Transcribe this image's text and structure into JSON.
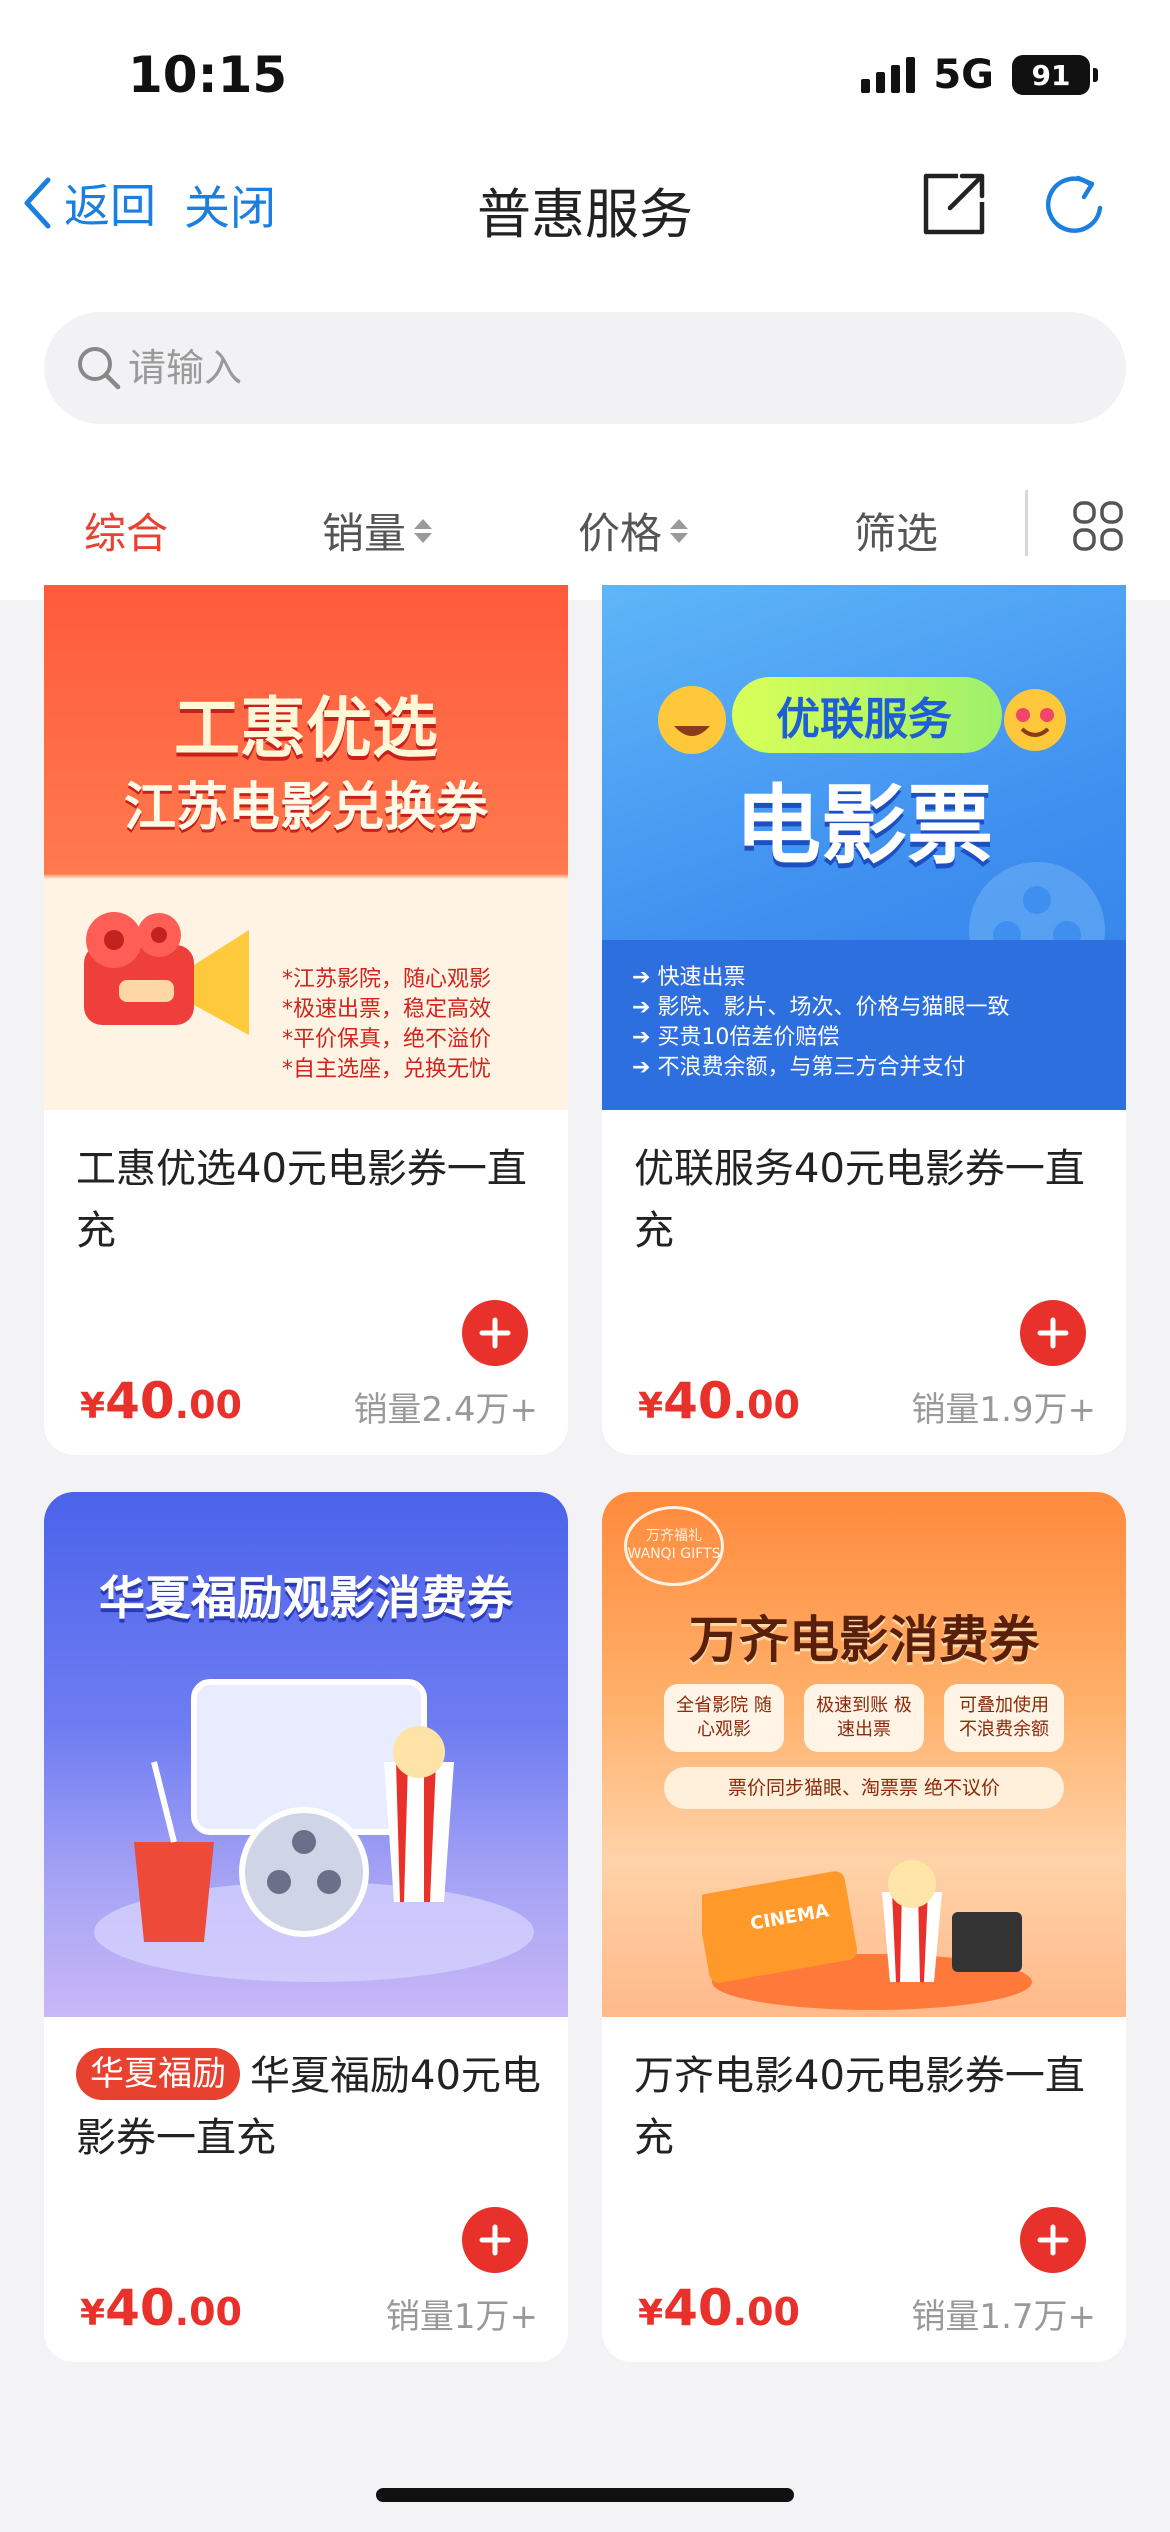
{
  "status_bar": {
    "time": "10:15",
    "network": "5G",
    "battery": "91"
  },
  "nav": {
    "back_label": "返回",
    "close_label": "关闭",
    "title": "普惠服务"
  },
  "search": {
    "placeholder": "请输入"
  },
  "sort_tabs": {
    "comprehensive": "综合",
    "sales": "销量",
    "price": "价格",
    "filter": "筛选"
  },
  "colors": {
    "accent_red": "#e8312a",
    "link_blue": "#1a7fe0"
  },
  "products": [
    {
      "title": "工惠优选40元电影券一直充",
      "price_symbol": "¥",
      "price_int": "40",
      "price_dec": ".00",
      "sales": "销量2.4万+",
      "banner": {
        "line1": "工惠优选",
        "line2": "江苏电影兑换券",
        "bullets": [
          "*江苏影院，随心观影",
          "*极速出票，稳定高效",
          "*平价保真，绝不溢价",
          "*自主选座，兑换无忧"
        ]
      }
    },
    {
      "title": "优联服务40元电影券一直充",
      "price_symbol": "¥",
      "price_int": "40",
      "price_dec": ".00",
      "sales": "销量1.9万+",
      "banner": {
        "line1": "优联服务",
        "line2": "电影票",
        "bullets": [
          "快速出票",
          "影院、影片、场次、价格与猫眼一致",
          "买贵10倍差价赔偿",
          "不浪费余额，与第三方合并支付"
        ]
      }
    },
    {
      "tag": "华夏福励",
      "title": "华夏福励40元电影券一直充",
      "price_symbol": "¥",
      "price_int": "40",
      "price_dec": ".00",
      "sales": "销量1万+",
      "banner": {
        "line1": "华夏福励观影消费券"
      }
    },
    {
      "title": "万齐电影40元电影券一直充",
      "price_symbol": "¥",
      "price_int": "40",
      "price_dec": ".00",
      "sales": "销量1.7万+",
      "banner": {
        "logo": "万齐福礼 WANQI GIFTS",
        "line1": "万齐电影消费券",
        "features": [
          "全省影院 随心观影",
          "极速到账 极速出票",
          "可叠加使用 不浪费余额"
        ],
        "note": "票价同步猫眼、淘票票 绝不议价",
        "ticket_text": "CINEMA"
      }
    }
  ]
}
